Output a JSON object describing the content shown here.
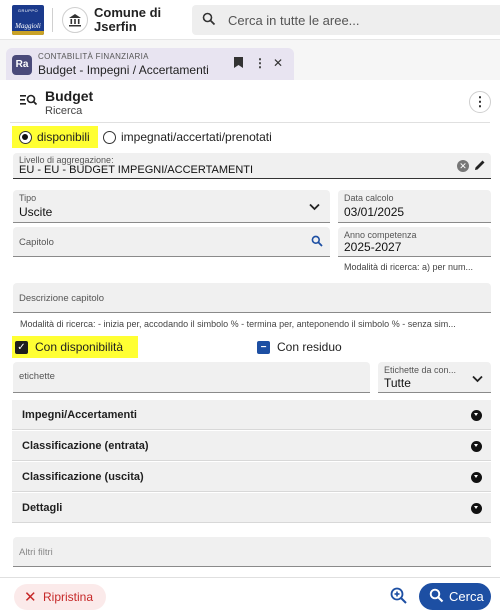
{
  "top": {
    "logo_line1": "GRUPPO",
    "logo_line2": "Maggioli",
    "comune_line1": "Comune di",
    "comune_line2": "Jserfin",
    "search_placeholder": "Cerca in tutte le aree..."
  },
  "tab": {
    "badge": "Ra",
    "section": "CONTABILITÀ FINANZIARIA",
    "title": "Budget - Impegni / Accertamenti"
  },
  "header": {
    "title": "Budget",
    "subtitle": "Ricerca"
  },
  "radio": {
    "option1": "disponibili",
    "option2": "impegnati/accertati/prenotati",
    "selected": "disponibili"
  },
  "livello": {
    "label": "Livello di aggregazione:",
    "value": "EU - EU - BUDGET IMPEGNI/ACCERTAMENTI"
  },
  "tipo": {
    "label": "Tipo",
    "value": "Uscite"
  },
  "data_calcolo": {
    "label": "Data calcolo",
    "value": "03/01/2025"
  },
  "capitolo": {
    "placeholder": "Capitolo"
  },
  "anno": {
    "label": "Anno competenza",
    "value": "2025-2027"
  },
  "anno_hint": "Modalità di ricerca: a) per num...",
  "descrizione": {
    "placeholder": "Descrizione capitolo"
  },
  "desc_hint": "Modalità di ricerca: - inizia per, accodando il simbolo % - termina per, anteponendo il simbolo % - senza sim...",
  "checks": {
    "disponibilita": "Con disponibilità",
    "residuo": "Con residuo"
  },
  "etichette": {
    "placeholder": "etichette"
  },
  "etichette_select": {
    "label": "Etichette da con...",
    "value": "Tutte"
  },
  "accordions": [
    "Impegni/Accertamenti",
    "Classificazione (entrata)",
    "Classificazione (uscita)",
    "Dettagli"
  ],
  "altri_filtri": {
    "placeholder": "Altri filtri"
  },
  "footer": {
    "reset": "Ripristina",
    "search": "Cerca"
  },
  "colors": {
    "highlight": "#ffff33",
    "primary": "#1d4fa3",
    "danger": "#c62828"
  }
}
